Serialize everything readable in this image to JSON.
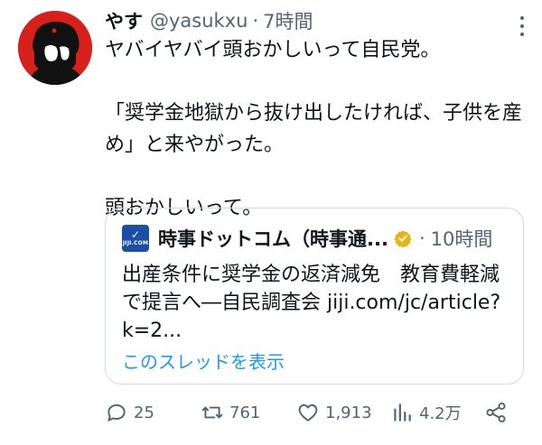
{
  "tweet": {
    "author_name": "やす",
    "author_handle": "@yasukxu",
    "separator": "·",
    "time": "7時間",
    "text": "ヤバイヤバイ頭おかしいって自民党。\n\n「奨学金地獄から抜け出したければ、子供を産め」と来やがった。\n\n頭おかしいって。"
  },
  "quote": {
    "logo_text": "JIJI.COM",
    "author_name": "時事ドットコム（時事通...",
    "separator": "·",
    "time": "10時間",
    "text": "出産条件に奨学金の返済減免　教育費軽減で提言へ―自民調査会 jiji.com/jc/article?k=2...",
    "thread_link": "このスレッドを表示"
  },
  "actions": {
    "replies": "25",
    "retweets": "761",
    "likes": "1,913",
    "views": "4.2万"
  },
  "colors": {
    "accent": "#1d9bf0",
    "secondary_text": "#536471",
    "avatar_bg": "#d6201c",
    "verified_badge": "#e2b719"
  },
  "icons": {
    "reply": "reply-icon",
    "retweet": "retweet-icon",
    "like": "heart-icon",
    "views": "views-icon",
    "share": "share-icon",
    "more": "more-icon"
  }
}
